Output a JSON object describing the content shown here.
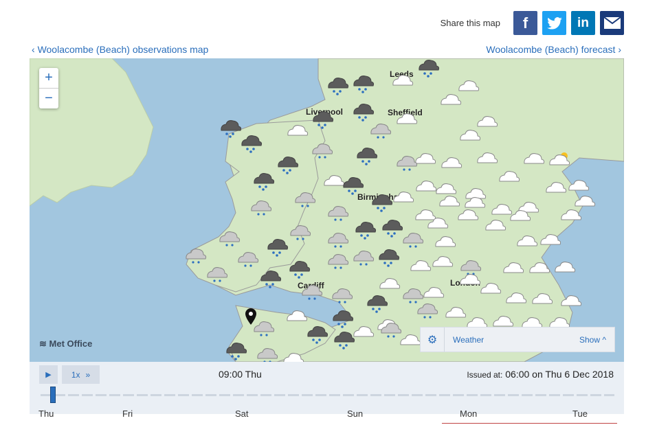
{
  "share": {
    "label": "Share this map",
    "facebook_icon": "facebook-icon",
    "twitter_icon": "twitter-icon",
    "linkedin_icon": "linkedin-icon",
    "email_icon": "email-icon"
  },
  "nav": {
    "left": "Woolacombe (Beach) observations map",
    "right": "Woolacombe (Beach) forecast"
  },
  "map": {
    "zoom_in": "+",
    "zoom_out": "−",
    "logo": "Met Office",
    "places": [
      "Leeds",
      "Liverpool",
      "Sheffield",
      "Birmingham",
      "Cardiff",
      "London"
    ],
    "colors": {
      "sea": "#a2c6df",
      "land": "#d4e7c4",
      "accent": "#2a6ebb"
    },
    "layer": {
      "name": "Weather",
      "show": "Show"
    }
  },
  "timeline": {
    "current_time": "09:00 Thu",
    "speed": "1x",
    "issued_label": "Issued at:",
    "issued_value": "06:00 on Thu 6 Dec 2018",
    "progress_fraction": 0.01,
    "days": [
      "Thu",
      "Fri",
      "Sat",
      "Sun",
      "Mon",
      "Tue"
    ]
  }
}
